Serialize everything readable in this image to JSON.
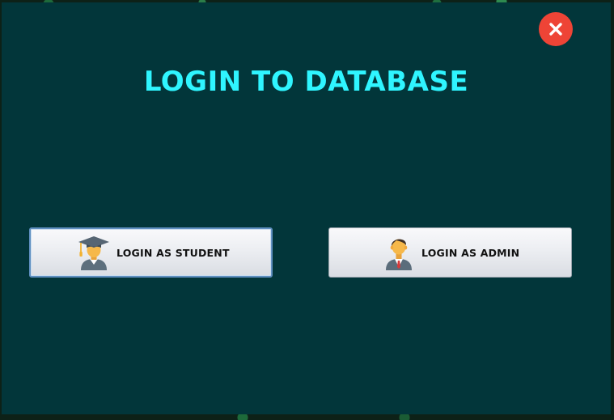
{
  "window": {
    "title": "LOGIN TO DATABASE",
    "close_icon": "close-icon",
    "colors": {
      "background": "#02363a",
      "title": "#2ff5ff",
      "close": "#ee4436"
    }
  },
  "buttons": {
    "student": {
      "label": "LOGIN AS STUDENT",
      "icon": "graduate-student-icon"
    },
    "admin": {
      "label": "LOGIN AS ADMIN",
      "icon": "admin-user-icon"
    }
  }
}
